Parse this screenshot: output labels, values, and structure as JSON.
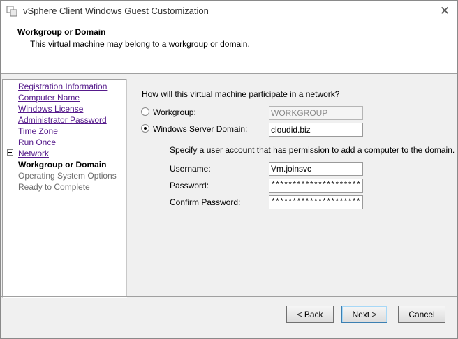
{
  "window": {
    "title": "vSphere Client Windows Guest Customization"
  },
  "header": {
    "title": "Workgroup or Domain",
    "subtitle": "This virtual machine may belong to a workgroup or domain."
  },
  "sidebar": {
    "items": [
      {
        "label": "Registration Information",
        "state": "link"
      },
      {
        "label": "Computer Name",
        "state": "link"
      },
      {
        "label": "Windows License",
        "state": "link"
      },
      {
        "label": "Administrator Password",
        "state": "link"
      },
      {
        "label": "Time Zone",
        "state": "link"
      },
      {
        "label": "Run Once",
        "state": "link"
      },
      {
        "label": "Network",
        "state": "link",
        "expandable": true
      },
      {
        "label": "Workgroup or Domain",
        "state": "current"
      },
      {
        "label": "Operating System Options",
        "state": "disabled"
      },
      {
        "label": "Ready to Complete",
        "state": "disabled"
      }
    ]
  },
  "content": {
    "question": "How will this virtual machine participate in a network?",
    "workgroup": {
      "label": "Workgroup:",
      "selected": false,
      "value": "WORKGROUP",
      "enabled": false
    },
    "domain": {
      "label": "Windows Server Domain:",
      "selected": true,
      "value": "cloudid.biz"
    },
    "account_prompt": "Specify a user account that has permission to add a computer to the domain.",
    "username": {
      "label": "Username:",
      "value": "Vm.joinsvc"
    },
    "password": {
      "label": "Password:",
      "value": "************************"
    },
    "confirm_password": {
      "label": "Confirm Password:",
      "value": "************************"
    }
  },
  "footer": {
    "back_label": "< Back",
    "next_label": "Next >",
    "cancel_label": "Cancel"
  },
  "colors": {
    "link": "#551a8b",
    "disabled_text": "#6d6d6d",
    "default_button_border": "#3c7fb1"
  },
  "icons": {
    "app": "vsphere-app-icon",
    "close": "close-icon",
    "expand": "plus-expand-icon"
  }
}
